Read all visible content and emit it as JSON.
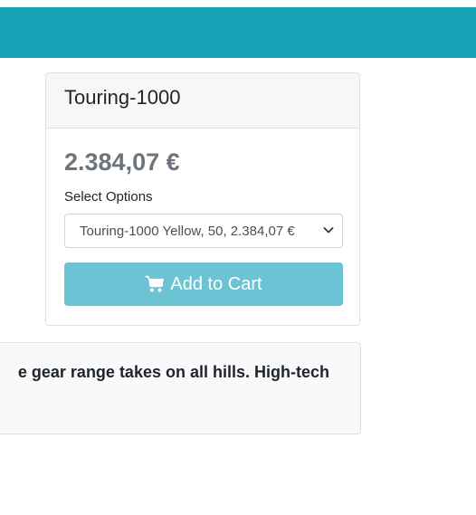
{
  "header": {
    "bar_color": "#17a2b8"
  },
  "product": {
    "name": "Touring-1000",
    "price": "2.384,07 €",
    "select_label": "Select Options",
    "selected_option": "Touring-1000 Yellow, 50, 2.384,07 €",
    "add_to_cart_label": "Add to Cart",
    "cart_icon": "shopping-cart-icon"
  },
  "description": {
    "text": "e gear range takes on all hills. High-tech"
  }
}
